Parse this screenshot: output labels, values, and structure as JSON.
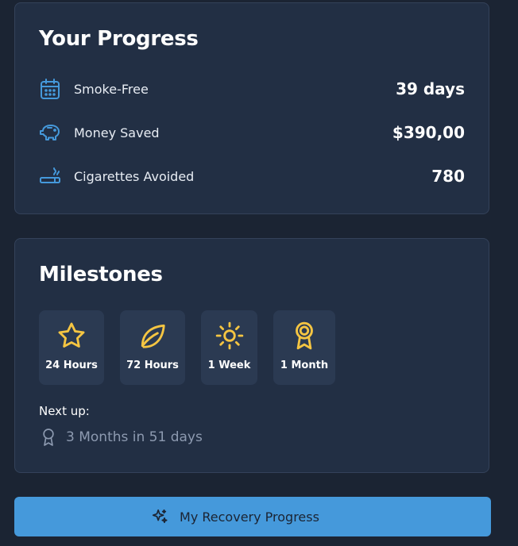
{
  "progress": {
    "title": "Your Progress",
    "stats": [
      {
        "icon": "calendar-icon",
        "label": "Smoke-Free",
        "value": "39 days"
      },
      {
        "icon": "piggy-bank-icon",
        "label": "Money Saved",
        "value": "$390,00"
      },
      {
        "icon": "cigarette-icon",
        "label": "Cigarettes Avoided",
        "value": "780"
      }
    ]
  },
  "milestones": {
    "title": "Milestones",
    "items": [
      {
        "icon": "star-icon",
        "label": "24 Hours"
      },
      {
        "icon": "leaf-icon",
        "label": "72 Hours"
      },
      {
        "icon": "sun-icon",
        "label": "1 Week"
      },
      {
        "icon": "award-icon",
        "label": "1 Month"
      }
    ],
    "next_up_label": "Next up:",
    "next_up_icon": "award-icon",
    "next_up_text": "3 Months in 51 days"
  },
  "cta": {
    "icon": "sparkles-icon",
    "label": "My Recovery Progress"
  },
  "colors": {
    "background": "#1b2433",
    "card": "#222f44",
    "accent_blue": "#4599db",
    "milestone_gold": "#f5c542",
    "muted_text": "#8d9ab0"
  }
}
